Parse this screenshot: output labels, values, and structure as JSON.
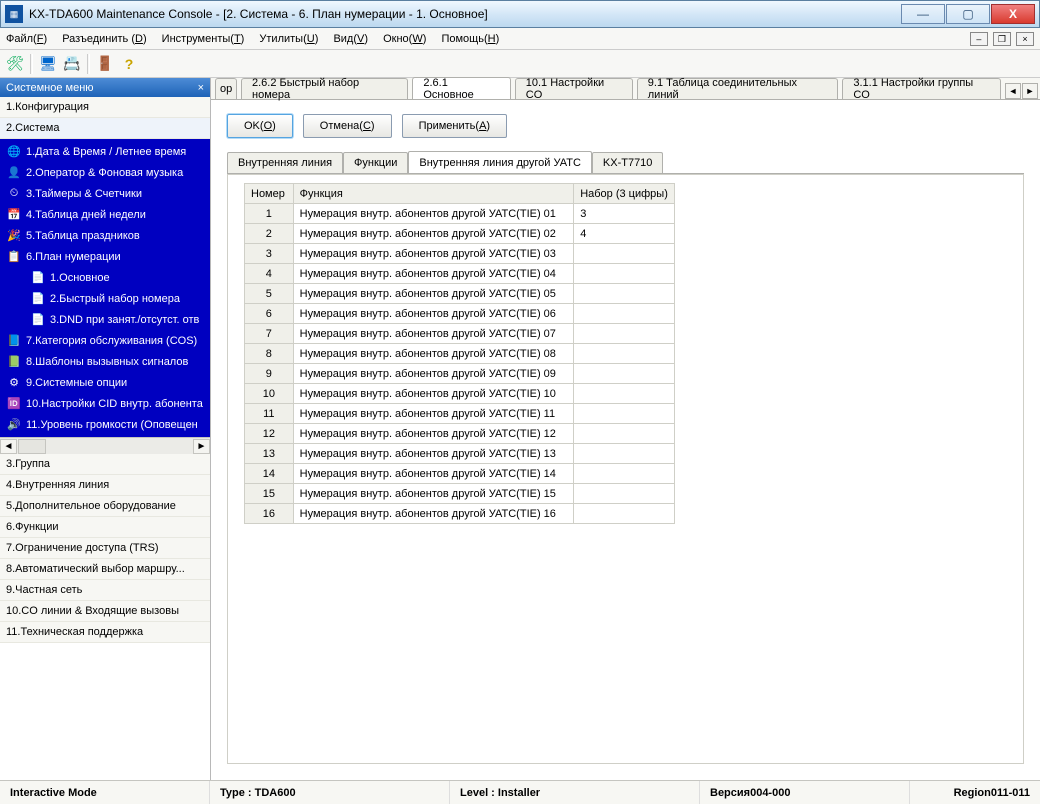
{
  "window": {
    "title": "KX-TDA600 Maintenance Console - [2. Система - 6. План нумерации - 1. Основное]"
  },
  "menu": {
    "file": "Файл(F)",
    "disconnect": "Разъединить (D)",
    "tools": "Инструменты(T)",
    "utilities": "Утилиты(U)",
    "view": "Вид(V)",
    "window": "Окно(W)",
    "help": "Помощь(H)"
  },
  "sidebar": {
    "header": "Системное меню",
    "top_items": [
      "1.Конфигурация",
      "2.Система"
    ],
    "blue_items": [
      {
        "icon": "🌐",
        "label": "1.Дата & Время / Летнее время"
      },
      {
        "icon": "👤",
        "label": "2.Оператор & Фоновая музыка"
      },
      {
        "icon": "⏲",
        "label": "3.Таймеры & Счетчики"
      },
      {
        "icon": "📅",
        "label": "4.Таблица дней недели"
      },
      {
        "icon": "🎉",
        "label": "5.Таблица праздников"
      },
      {
        "icon": "📋",
        "label": "6.План нумерации"
      }
    ],
    "sub_items": [
      {
        "icon": "📄",
        "label": "1.Основное"
      },
      {
        "icon": "📄",
        "label": "2.Быстрый набор номера"
      },
      {
        "icon": "📄",
        "label": "3.DND при занят./отсутст. отв"
      }
    ],
    "blue_items2": [
      {
        "icon": "📘",
        "label": "7.Категория обслуживания (COS)"
      },
      {
        "icon": "📗",
        "label": "8.Шаблоны вызывных сигналов"
      },
      {
        "icon": "⚙",
        "label": "9.Системные опции"
      },
      {
        "icon": "🆔",
        "label": "10.Настройки CID внутр. абонента"
      },
      {
        "icon": "🔊",
        "label": "11.Уровень громкости (Оповещен"
      }
    ],
    "bottom_items": [
      "3.Группа",
      "4.Внутренняя линия",
      "5.Дополнительное оборудование",
      "6.Функции",
      "7.Ограничение доступа (TRS)",
      "8.Автоматический выбор маршру...",
      "9.Частная сеть",
      "10.CO линии & Входящие вызовы",
      "11.Техническая поддержка"
    ]
  },
  "top_tabs": {
    "trunc": "ор",
    "items": [
      "2.6.2 Быстрый набор номера",
      "2.6.1 Основное",
      "10.1 Настройки CO",
      "9.1 Таблица соединительных линий",
      "3.1.1 Настройки группы CO"
    ],
    "active_index": 1
  },
  "buttons": {
    "ok": "OK(O)",
    "cancel": "Отмена(C)",
    "apply": "Применить(A)"
  },
  "sub_tabs": {
    "items": [
      "Внутренняя линия",
      "Функции",
      "Внутренняя линия другой УАТС",
      "KX-T7710"
    ],
    "active_index": 2
  },
  "table": {
    "headers": {
      "num": "Номер",
      "func": "Функция",
      "dial": "Набор (3 цифры)"
    },
    "rows": [
      {
        "n": "1",
        "f": "Нумерация внутр. абонентов другой УАТС(TIE) 01",
        "d": "3"
      },
      {
        "n": "2",
        "f": "Нумерация внутр. абонентов другой УАТС(TIE) 02",
        "d": "4"
      },
      {
        "n": "3",
        "f": "Нумерация внутр. абонентов другой УАТС(TIE) 03",
        "d": ""
      },
      {
        "n": "4",
        "f": "Нумерация внутр. абонентов другой УАТС(TIE) 04",
        "d": ""
      },
      {
        "n": "5",
        "f": "Нумерация внутр. абонентов другой УАТС(TIE) 05",
        "d": ""
      },
      {
        "n": "6",
        "f": "Нумерация внутр. абонентов другой УАТС(TIE) 06",
        "d": ""
      },
      {
        "n": "7",
        "f": "Нумерация внутр. абонентов другой УАТС(TIE) 07",
        "d": ""
      },
      {
        "n": "8",
        "f": "Нумерация внутр. абонентов другой УАТС(TIE) 08",
        "d": ""
      },
      {
        "n": "9",
        "f": "Нумерация внутр. абонентов другой УАТС(TIE) 09",
        "d": ""
      },
      {
        "n": "10",
        "f": "Нумерация внутр. абонентов другой УАТС(TIE) 10",
        "d": ""
      },
      {
        "n": "11",
        "f": "Нумерация внутр. абонентов другой УАТС(TIE) 11",
        "d": ""
      },
      {
        "n": "12",
        "f": "Нумерация внутр. абонентов другой УАТС(TIE) 12",
        "d": ""
      },
      {
        "n": "13",
        "f": "Нумерация внутр. абонентов другой УАТС(TIE) 13",
        "d": ""
      },
      {
        "n": "14",
        "f": "Нумерация внутр. абонентов другой УАТС(TIE) 14",
        "d": ""
      },
      {
        "n": "15",
        "f": "Нумерация внутр. абонентов другой УАТС(TIE) 15",
        "d": ""
      },
      {
        "n": "16",
        "f": "Нумерация внутр. абонентов другой УАТС(TIE) 16",
        "d": ""
      }
    ]
  },
  "status": {
    "mode": "Interactive Mode",
    "type": "Type : TDA600",
    "level": "Level : Installer",
    "version": "Версия004-000",
    "region": "Region011-011"
  }
}
